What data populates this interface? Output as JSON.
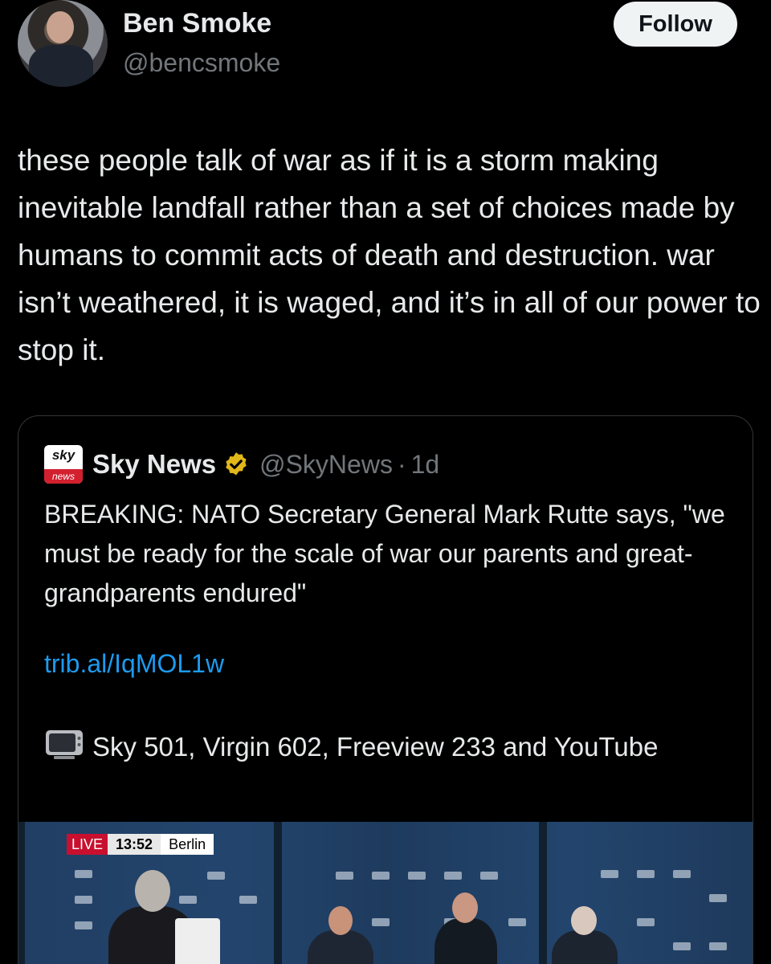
{
  "author": {
    "name": "Ben Smoke",
    "handle": "@bencsmoke",
    "follow_label": "Follow"
  },
  "tweet": {
    "text": "these people talk of war as if it is a storm making inevitable landfall rather than a set of choices made by humans to commit acts of death and destruction. war isn’t weathered, it is waged, and it’s in all of our power to stop it."
  },
  "quoted": {
    "logo_top": "sky",
    "logo_bottom": "news",
    "name": "Sky News",
    "handle": "@SkyNews",
    "separator": "·",
    "time": "1d",
    "body": "BREAKING: NATO Secretary General Mark Rutte says, \"we must be ready for the scale of war our parents and great-grandparents endured\"",
    "link": "trib.al/IqMOL1w",
    "tv_icon": "television-icon",
    "tv_text": "Sky 501, Virgin 602, Freeview 233 and YouTube",
    "media": {
      "live_label": "LIVE",
      "clock": "13:52",
      "city": "Berlin"
    }
  },
  "colors": {
    "background": "#000000",
    "text": "#e7e9ea",
    "muted": "#71767b",
    "link": "#1d9bf0",
    "verified": "#e2b719",
    "live_red": "#c8102e"
  }
}
